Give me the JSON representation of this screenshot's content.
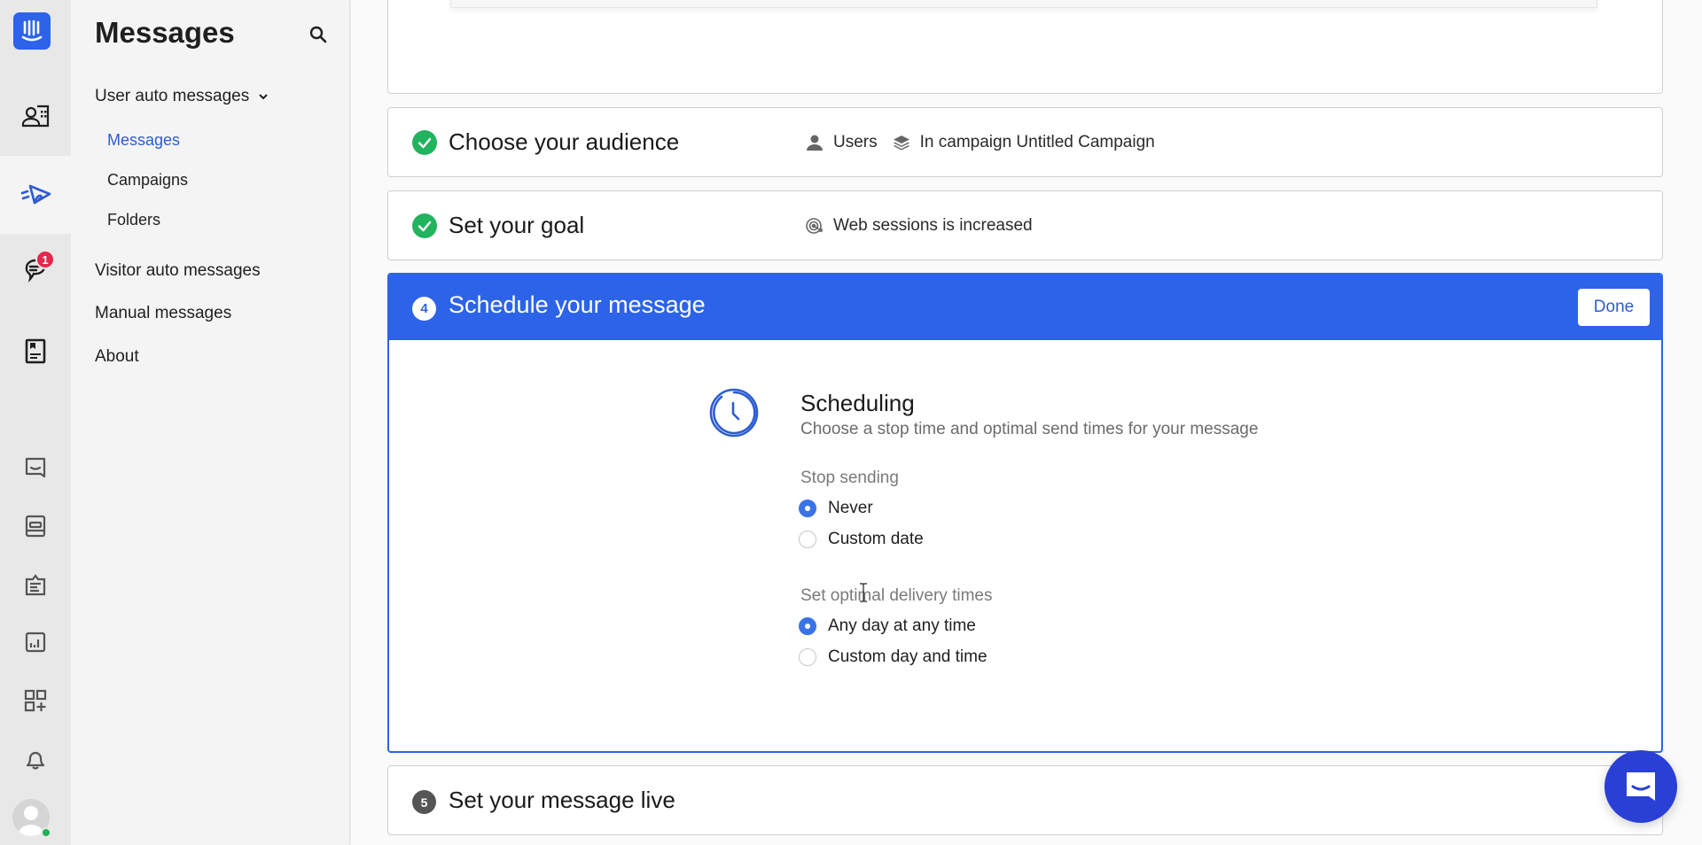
{
  "rail": {
    "items": [
      {
        "name": "contacts",
        "icon": "contacts-icon"
      },
      {
        "name": "outbound",
        "icon": "outbound-send-icon",
        "active": true
      },
      {
        "name": "inbox",
        "icon": "conversations-icon",
        "badge": "1"
      },
      {
        "name": "articles",
        "icon": "articles-icon"
      }
    ],
    "lower_items": [
      {
        "name": "messenger",
        "icon": "messenger-icon"
      },
      {
        "name": "operator",
        "icon": "operator-icon"
      },
      {
        "name": "tickets",
        "icon": "clipboard-icon"
      },
      {
        "name": "reports",
        "icon": "reports-icon"
      },
      {
        "name": "app-store",
        "icon": "apps-add-icon"
      },
      {
        "name": "notifications",
        "icon": "bell-icon"
      }
    ],
    "status_color": "#1fb25a",
    "brand_color": "#2c63e8"
  },
  "subnav": {
    "title": "Messages",
    "groups": [
      {
        "label": "User auto messages",
        "expanded": true,
        "children": [
          {
            "label": "Messages",
            "active": true
          },
          {
            "label": "Campaigns"
          },
          {
            "label": "Folders"
          }
        ]
      },
      {
        "label": "Visitor auto messages"
      },
      {
        "label": "Manual messages"
      },
      {
        "label": "About"
      }
    ]
  },
  "steps": [
    {
      "title": "Choose your audience",
      "status": "complete",
      "summary": [
        {
          "icon": "user-icon",
          "text": "Users"
        },
        {
          "icon": "layers-icon",
          "text": "In campaign Untitled Campaign"
        }
      ]
    },
    {
      "title": "Set your goal",
      "status": "complete",
      "summary": [
        {
          "icon": "target-icon",
          "text": "Web sessions is increased"
        }
      ]
    },
    {
      "number": "4",
      "title": "Schedule your message",
      "status": "active",
      "done_label": "Done",
      "section": {
        "title": "Scheduling",
        "subtitle": "Choose a stop time and optimal send times for your message",
        "stop_sending": {
          "label": "Stop sending",
          "options": [
            {
              "label": "Never",
              "selected": true
            },
            {
              "label": "Custom date",
              "selected": false
            }
          ]
        },
        "delivery_times": {
          "label": "Set optimal delivery times",
          "options": [
            {
              "label": "Any day at any time",
              "selected": true
            },
            {
              "label": "Custom day and time",
              "selected": false
            }
          ]
        }
      }
    },
    {
      "number": "5",
      "title": "Set your message live",
      "status": "pending"
    }
  ],
  "colors": {
    "accent": "#2c63e8",
    "success": "#22b35e",
    "radio_selected": "#3a73e6",
    "messenger": "#2a3fd6"
  }
}
